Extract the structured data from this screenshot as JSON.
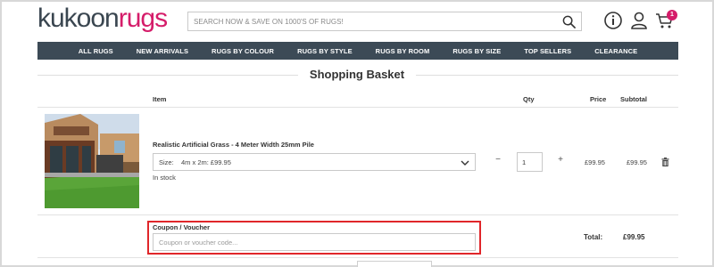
{
  "header": {
    "logo_part1": "kukoon",
    "logo_part2": "rugs",
    "search_placeholder": "SEARCH NOW & SAVE ON 1000'S OF RUGS!",
    "icons": [
      "search-icon",
      "info-icon",
      "account-icon",
      "cart-icon"
    ],
    "cart_count": "1"
  },
  "nav": {
    "items": [
      "ALL RUGS",
      "NEW ARRIVALS",
      "RUGS BY COLOUR",
      "RUGS BY STYLE",
      "RUGS BY ROOM",
      "RUGS BY SIZE",
      "TOP SELLERS",
      "CLEARANCE"
    ]
  },
  "page": {
    "title": "Shopping Basket"
  },
  "table": {
    "columns": {
      "item": "Item",
      "qty": "Qty",
      "price": "Price",
      "subtotal": "Subtotal"
    }
  },
  "product": {
    "name": "Realistic Artificial Grass - 4 Meter Width 25mm Pile",
    "size_label": "Size:",
    "size_value": "4m x 2m:  £99.95",
    "stock": "In stock",
    "quantity": "1",
    "minus": "−",
    "plus": "+",
    "price": "£99.95",
    "subtotal": "£99.95"
  },
  "coupon": {
    "label": "Coupon / Voucher",
    "placeholder": "Coupon or voucher code..."
  },
  "totals": {
    "label": "Total:",
    "value": "£99.95"
  },
  "colors": {
    "brand_pink": "#d51d6a",
    "brand_dark": "#3a4650",
    "nav_bg": "#3c4a56",
    "highlight_red": "#e0262a"
  }
}
